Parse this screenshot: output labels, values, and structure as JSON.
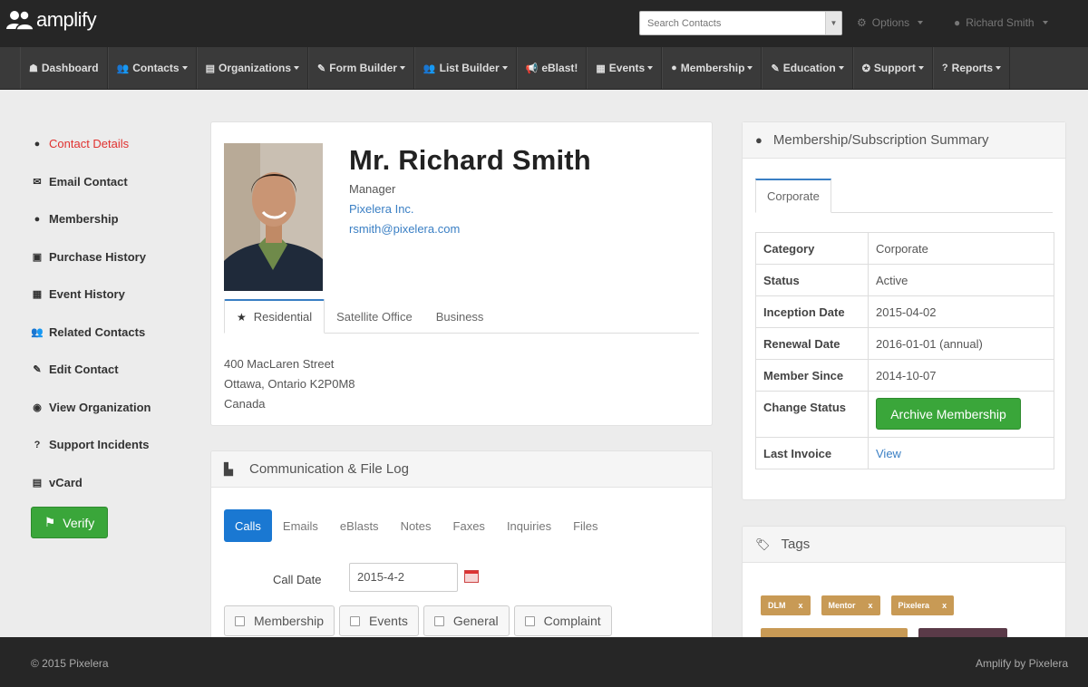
{
  "app": {
    "name": "amplify"
  },
  "topbar": {
    "search_placeholder": "Search Contacts",
    "options_label": "Options",
    "user_label": "Richard Smith"
  },
  "nav": [
    {
      "label": "Dashboard",
      "icon": "dashboard-icon",
      "glyph": "☗",
      "caret": false
    },
    {
      "label": "Contacts",
      "icon": "contacts-icon",
      "glyph": "👥",
      "caret": true
    },
    {
      "label": "Organizations",
      "icon": "organizations-icon",
      "glyph": "▤",
      "caret": true
    },
    {
      "label": "Form Builder",
      "icon": "form-builder-icon",
      "glyph": "✎",
      "caret": true
    },
    {
      "label": "List Builder",
      "icon": "list-builder-icon",
      "glyph": "👥",
      "caret": true
    },
    {
      "label": "eBlast!",
      "icon": "megaphone-icon",
      "glyph": "📢",
      "caret": false
    },
    {
      "label": "Events",
      "icon": "calendar-icon",
      "glyph": "▦",
      "caret": true
    },
    {
      "label": "Membership",
      "icon": "user-icon",
      "glyph": "●",
      "caret": true
    },
    {
      "label": "Education",
      "icon": "book-icon",
      "glyph": "✎",
      "caret": true
    },
    {
      "label": "Support",
      "icon": "support-icon",
      "glyph": "✪",
      "caret": true
    },
    {
      "label": "Reports",
      "icon": "reports-icon",
      "glyph": "?",
      "caret": true
    }
  ],
  "sidebar": {
    "items": [
      {
        "label": "Contact Details",
        "icon": "user-icon",
        "glyph": "●",
        "active": true
      },
      {
        "label": "Email Contact",
        "icon": "envelope-icon",
        "glyph": "✉",
        "active": false
      },
      {
        "label": "Membership",
        "icon": "user-icon",
        "glyph": "●",
        "active": false
      },
      {
        "label": "Purchase History",
        "icon": "money-icon",
        "glyph": "▣",
        "active": false
      },
      {
        "label": "Event History",
        "icon": "calendar-icon",
        "glyph": "▦",
        "active": false
      },
      {
        "label": "Related Contacts",
        "icon": "users-icon",
        "glyph": "👥",
        "active": false
      },
      {
        "label": "Edit Contact",
        "icon": "edit-icon",
        "glyph": "✎",
        "active": false
      },
      {
        "label": "View Organization",
        "icon": "eye-icon",
        "glyph": "◉",
        "active": false
      },
      {
        "label": "Support Incidents",
        "icon": "question-icon",
        "glyph": "?",
        "active": false
      },
      {
        "label": "vCard",
        "icon": "vcard-icon",
        "glyph": "▤",
        "active": false
      }
    ],
    "verify_label": "Verify"
  },
  "profile": {
    "name": "Mr. Richard Smith",
    "title": "Manager",
    "company": "Pixelera Inc.",
    "email": "rsmith@pixelera.com",
    "address_tabs": [
      "Residential",
      "Satellite Office",
      "Business"
    ],
    "address_lines": [
      "400 MacLaren Street",
      "Ottawa, Ontario K2P0M8",
      "Canada"
    ]
  },
  "commlog": {
    "title": "Communication & File Log",
    "tabs": [
      "Calls",
      "Emails",
      "eBlasts",
      "Notes",
      "Faxes",
      "Inquiries",
      "Files"
    ],
    "call_date_label": "Call Date",
    "call_date_value": "2015-4-2",
    "checkboxes": [
      "Membership",
      "Events",
      "General",
      "Complaint"
    ]
  },
  "membership": {
    "title": "Membership/Subscription Summary",
    "tab": "Corporate",
    "rows": [
      {
        "key": "Category",
        "value": "Corporate"
      },
      {
        "key": "Status",
        "value": "Active"
      },
      {
        "key": "Inception Date",
        "value": "2015-04-02"
      },
      {
        "key": "Renewal Date",
        "value": "2016-01-01 (annual)"
      },
      {
        "key": "Member Since",
        "value": "2014-10-07"
      }
    ],
    "change_status_label": "Change Status",
    "archive_label": "Archive Membership",
    "last_invoice_label": "Last Invoice",
    "last_invoice_link": "View"
  },
  "tags": {
    "title": "Tags",
    "items": [
      {
        "label": "DLM",
        "color": "#c89a55"
      },
      {
        "label": "Mentor",
        "color": "#c89a55"
      },
      {
        "label": "Pixelera",
        "color": "#c89a55"
      }
    ],
    "remove_glyph": "x"
  },
  "footer": {
    "copyright": "© 2015 Pixelera",
    "credit": "Amplify by Pixelera"
  },
  "colors": {
    "accent_blue": "#1a78d2",
    "link_blue": "#3a7fc4",
    "success_green": "#3aa63a",
    "active_red": "#e0312f",
    "topbar_bg": "#262626"
  }
}
